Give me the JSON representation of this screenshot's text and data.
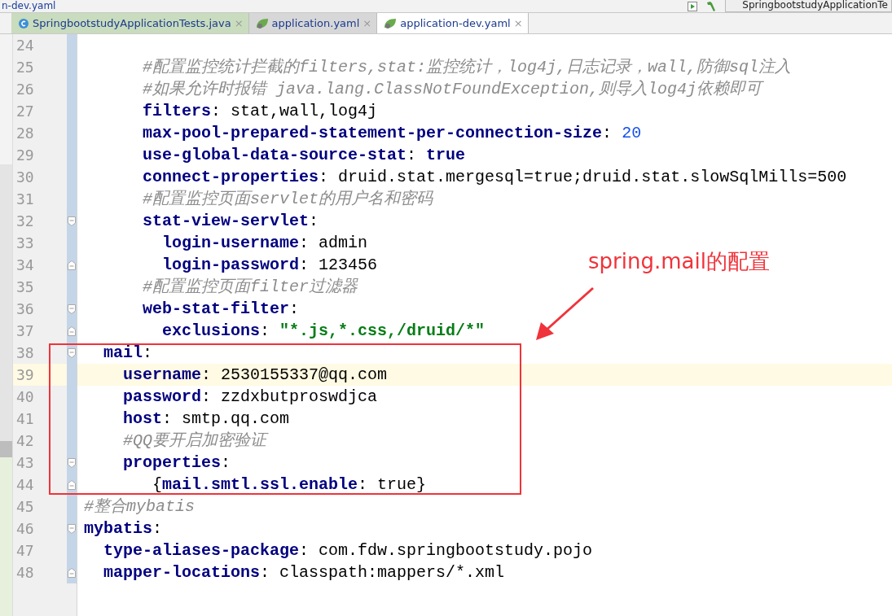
{
  "breadcrumb": "n-dev.yaml",
  "run_config": "SpringbootstudyApplicationTe",
  "tabs": [
    {
      "label": "SpringbootstudyApplicationTests.java",
      "kind": "java",
      "selected": false,
      "close": "×"
    },
    {
      "label": "application.yaml",
      "kind": "yaml",
      "selected": false,
      "close": "×"
    },
    {
      "label": "application-dev.yaml",
      "kind": "yaml",
      "selected": true,
      "close": "×"
    }
  ],
  "lines": [
    {
      "number": "24",
      "current": false,
      "fold_start": false,
      "fold_end": false
    },
    {
      "number": "25",
      "current": false,
      "fold_start": false,
      "fold_end": false,
      "segments": [
        {
          "text": "      #配置监控统计拦截的filters,stat:监控统计，log4j,日志记录，wall,防御sql注入",
          "kind": "comment"
        }
      ]
    },
    {
      "number": "26",
      "current": false,
      "fold_start": false,
      "fold_end": false,
      "segments": [
        {
          "text": "      #如果允许时报错 java.lang.ClassNotFoundException,则导入log4j依赖即可",
          "kind": "comment"
        }
      ]
    },
    {
      "number": "27",
      "current": false,
      "fold_start": false,
      "fold_end": false,
      "segments": [
        {
          "text": "      filters",
          "kind": "key"
        },
        {
          "text": ": stat,wall,log4j",
          "kind": "plain"
        }
      ]
    },
    {
      "number": "28",
      "current": false,
      "fold_start": false,
      "fold_end": false,
      "segments": [
        {
          "text": "      max-pool-prepared-statement-per-connection-size",
          "kind": "key"
        },
        {
          "text": ": ",
          "kind": "plain"
        },
        {
          "text": "20",
          "kind": "number"
        }
      ]
    },
    {
      "number": "29",
      "current": false,
      "fold_start": false,
      "fold_end": false,
      "segments": [
        {
          "text": "      use-global-data-source-stat",
          "kind": "key"
        },
        {
          "text": ": ",
          "kind": "plain"
        },
        {
          "text": "true",
          "kind": "keyword"
        }
      ]
    },
    {
      "number": "30",
      "current": false,
      "fold_start": false,
      "fold_end": false,
      "segments": [
        {
          "text": "      connect-properties",
          "kind": "key"
        },
        {
          "text": ": druid.stat.mergesql=true;druid.stat.slowSqlMills=500",
          "kind": "plain"
        }
      ]
    },
    {
      "number": "31",
      "current": false,
      "fold_start": false,
      "fold_end": false,
      "segments": [
        {
          "text": "      #配置监控页面servlet的用户名和密码",
          "kind": "comment"
        }
      ]
    },
    {
      "number": "32",
      "current": false,
      "fold_start": true,
      "fold_end": false,
      "segments": [
        {
          "text": "      stat-view-servlet",
          "kind": "key"
        },
        {
          "text": ":",
          "kind": "plain"
        }
      ]
    },
    {
      "number": "33",
      "current": false,
      "fold_start": false,
      "fold_end": false,
      "segments": [
        {
          "text": "        login-username",
          "kind": "key"
        },
        {
          "text": ": admin",
          "kind": "plain"
        }
      ]
    },
    {
      "number": "34",
      "current": false,
      "fold_start": false,
      "fold_end": true,
      "segments": [
        {
          "text": "        login-password",
          "kind": "key"
        },
        {
          "text": ": 123456",
          "kind": "plain"
        }
      ]
    },
    {
      "number": "35",
      "current": false,
      "fold_start": false,
      "fold_end": false,
      "segments": [
        {
          "text": "      #配置监控页面filter过滤器",
          "kind": "comment"
        }
      ]
    },
    {
      "number": "36",
      "current": false,
      "fold_start": true,
      "fold_end": false,
      "segments": [
        {
          "text": "      web-stat-filter",
          "kind": "key"
        },
        {
          "text": ":",
          "kind": "plain"
        }
      ]
    },
    {
      "number": "37",
      "current": false,
      "fold_start": false,
      "fold_end": true,
      "segments": [
        {
          "text": "        exclusions",
          "kind": "key"
        },
        {
          "text": ": ",
          "kind": "plain"
        },
        {
          "text": "\"*.js,*.css,/druid/*\"",
          "kind": "string"
        }
      ]
    },
    {
      "number": "38",
      "current": false,
      "fold_start": true,
      "fold_end": false,
      "segments": [
        {
          "text": "  mail",
          "kind": "key"
        },
        {
          "text": ":",
          "kind": "plain"
        }
      ]
    },
    {
      "number": "39",
      "current": true,
      "fold_start": false,
      "fold_end": false,
      "segments": [
        {
          "text": "    username",
          "kind": "key"
        },
        {
          "text": ": 2530155337@qq.com",
          "kind": "plain"
        }
      ]
    },
    {
      "number": "40",
      "current": false,
      "fold_start": false,
      "fold_end": false,
      "segments": [
        {
          "text": "    password",
          "kind": "key"
        },
        {
          "text": ": zzdxbutproswdjca",
          "kind": "plain"
        }
      ]
    },
    {
      "number": "41",
      "current": false,
      "fold_start": false,
      "fold_end": false,
      "segments": [
        {
          "text": "    host",
          "kind": "key"
        },
        {
          "text": ": smtp.qq.com",
          "kind": "plain"
        }
      ]
    },
    {
      "number": "42",
      "current": false,
      "fold_start": false,
      "fold_end": false,
      "segments": [
        {
          "text": "    #QQ要开启加密验证",
          "kind": "comment"
        }
      ]
    },
    {
      "number": "43",
      "current": false,
      "fold_start": true,
      "fold_end": false,
      "segments": [
        {
          "text": "    properties",
          "kind": "key"
        },
        {
          "text": ":",
          "kind": "plain"
        }
      ]
    },
    {
      "number": "44",
      "current": false,
      "fold_start": false,
      "fold_end": true,
      "segments": [
        {
          "text": "       {",
          "kind": "plain"
        },
        {
          "text": "mail.smtl.ssl.enable",
          "kind": "key"
        },
        {
          "text": ": true}",
          "kind": "plain"
        }
      ]
    },
    {
      "number": "45",
      "current": false,
      "fold_start": false,
      "fold_end": false,
      "segments": [
        {
          "text": "#整合mybatis",
          "kind": "comment"
        }
      ]
    },
    {
      "number": "46",
      "current": false,
      "fold_start": true,
      "fold_end": false,
      "segments": [
        {
          "text": "mybatis",
          "kind": "key"
        },
        {
          "text": ":",
          "kind": "plain"
        }
      ]
    },
    {
      "number": "47",
      "current": false,
      "fold_start": false,
      "fold_end": false,
      "segments": [
        {
          "text": "  type-aliases-package",
          "kind": "key"
        },
        {
          "text": ": com.fdw.springbootstudy.pojo",
          "kind": "plain"
        }
      ]
    },
    {
      "number": "48",
      "current": false,
      "fold_start": false,
      "fold_end": true,
      "segments": [
        {
          "text": "  mapper-locations",
          "kind": "key"
        },
        {
          "text": ": classpath:mappers/*.xml",
          "kind": "plain"
        }
      ]
    }
  ],
  "annotation": {
    "text": "spring.mail的配置"
  }
}
